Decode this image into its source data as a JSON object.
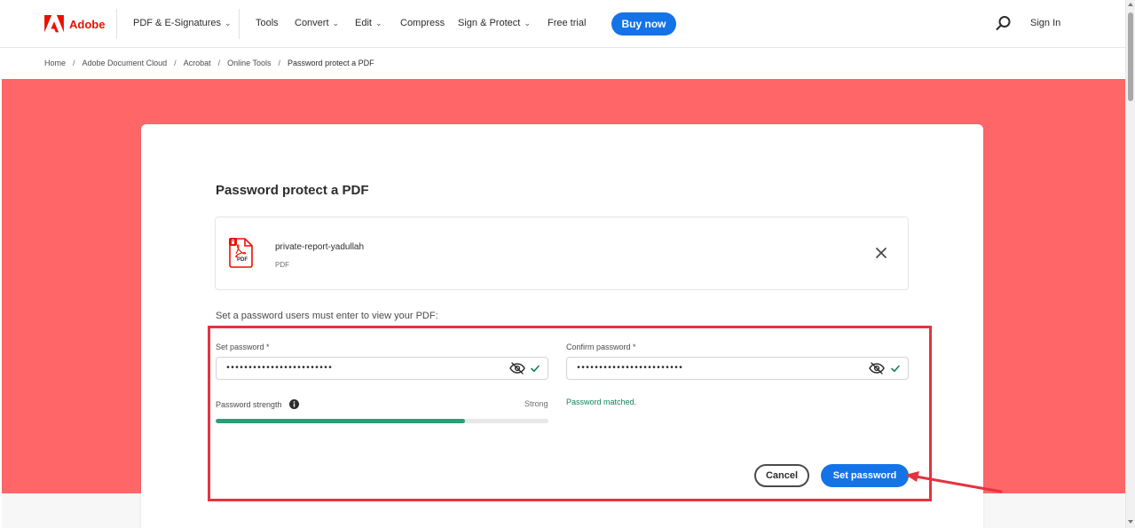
{
  "header": {
    "brand": "Adobe",
    "nav": [
      {
        "label": "PDF & E-Signatures",
        "dropdown": true
      },
      {
        "label": "Tools",
        "dropdown": false
      },
      {
        "label": "Convert",
        "dropdown": true
      },
      {
        "label": "Edit",
        "dropdown": true
      },
      {
        "label": "Compress",
        "dropdown": false
      },
      {
        "label": "Sign & Protect",
        "dropdown": true
      },
      {
        "label": "Free trial",
        "dropdown": false
      }
    ],
    "buy_now": "Buy now",
    "sign_in": "Sign In",
    "icons": {
      "search": "search-icon",
      "logo": "adobe-logo-icon"
    }
  },
  "breadcrumb": [
    "Home",
    "Adobe Document Cloud",
    "Acrobat",
    "Online Tools",
    "Password protect a PDF"
  ],
  "main": {
    "title": "Password protect a PDF",
    "file": {
      "name": "private-report-yadullah",
      "type": "PDF",
      "icon_label": "PDF"
    },
    "instruction": "Set a password users must enter to view your PDF:",
    "set_password": {
      "label": "Set password",
      "required_mark": "*",
      "value": "••••••••••••••••••••••••"
    },
    "confirm_password": {
      "label": "Confirm password",
      "required_mark": "*",
      "value": "••••••••••••••••••••••••"
    },
    "strength": {
      "label": "Password strength",
      "value_text": "Strong",
      "fill_percent": 75
    },
    "match_message": "Password matched.",
    "cancel_label": "Cancel",
    "submit_label": "Set password"
  },
  "colors": {
    "hero": "#ff6668",
    "accent": "#1473e6",
    "brand_red": "#eb1000",
    "strength": "#2d9d78",
    "success_text": "#12805c",
    "annotation": "#e4333f"
  }
}
